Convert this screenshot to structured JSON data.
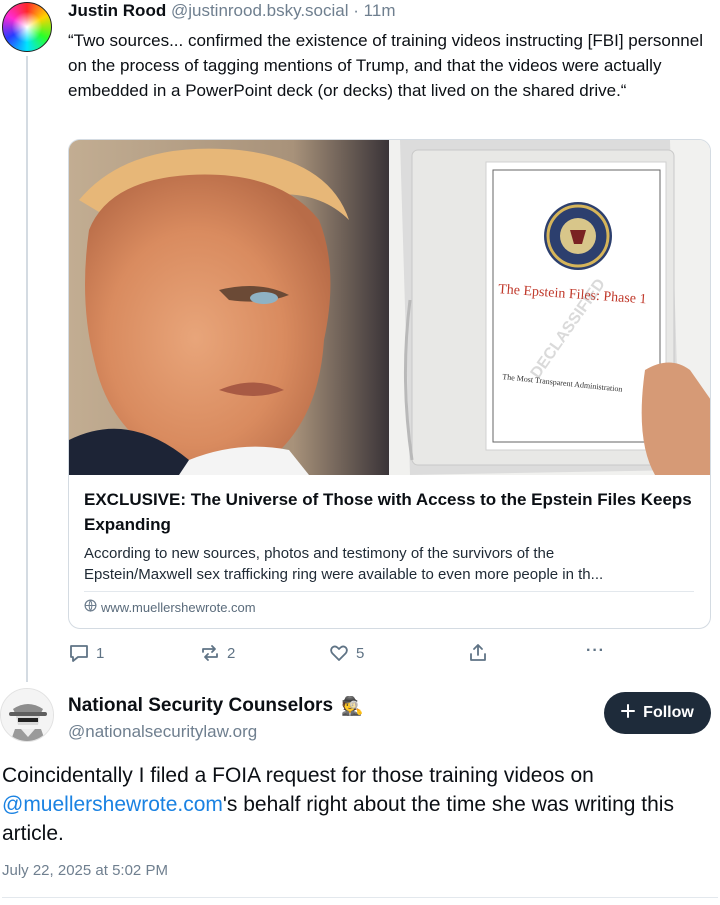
{
  "post": {
    "author_name": "Justin Rood",
    "author_handle": "@justinrood.bsky.social",
    "separator": "·",
    "time_ago": "11m",
    "text": "“Two sources... confirmed the existence of training videos instructing [FBI] personnel on the process of tagging mentions of Trump, and that the videos were actually embedded in a PowerPoint deck (or decks) that lived on the shared drive.“"
  },
  "link_card": {
    "binder_title": "The Epstein Files: Phase 1",
    "binder_stamp": "DECLASSIFIED",
    "binder_footer": "The Most Transparent Administration",
    "title": "EXCLUSIVE: The Universe of Those with Access to the Epstein Files Keeps Expanding",
    "description_line1": "According to new sources, photos and testimony of the survivors of the",
    "description_line2": "Epstein/Maxwell sex trafficking ring were available to even more people in th...",
    "domain": "www.muellershewrote.com"
  },
  "actions": {
    "reply_count": "1",
    "repost_count": "2",
    "like_count": "5",
    "more_label": "···"
  },
  "reply": {
    "author_name": "National Security Counselors",
    "author_emoji": "🕵",
    "author_handle": "@nationalsecuritylaw.org",
    "follow_label": "Follow",
    "text_before": "Coincidentally I filed a FOIA request for those training videos on ",
    "mention": "@muellershewrote.com",
    "text_after": "'s behalf right about the time she was writing this article.",
    "timestamp": "July 22, 2025 at 5:02 PM"
  },
  "colors": {
    "accent_link": "#1a82e2",
    "follow_button_bg": "#1e2b3a",
    "muted_text": "#6f7f8f",
    "icon_gray": "#5f7385"
  }
}
